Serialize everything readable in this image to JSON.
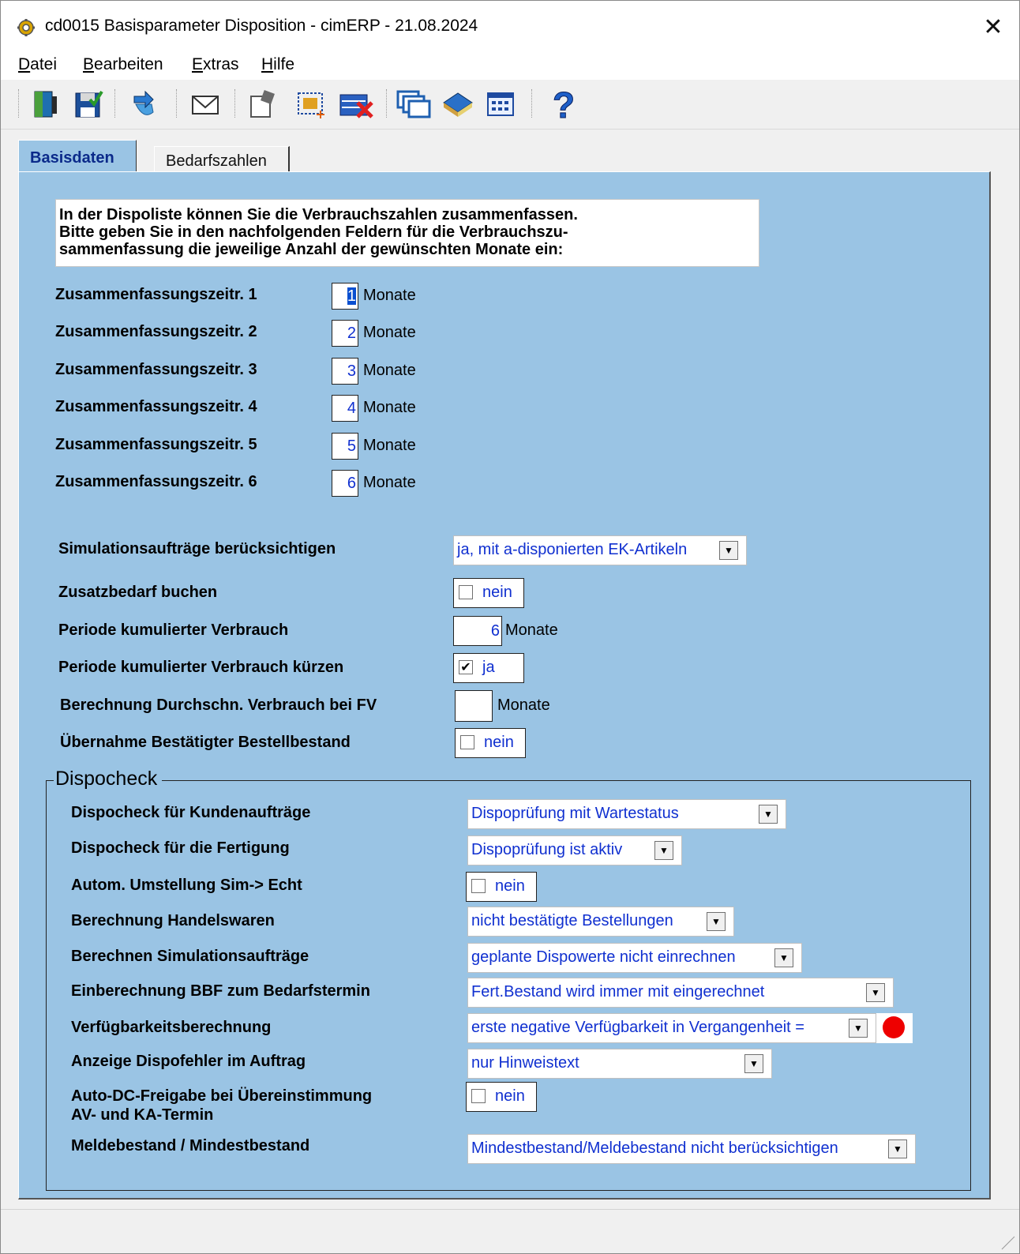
{
  "window": {
    "title": "cd0015 Basisparameter Disposition - cimERP - 21.08.2024",
    "close_glyph": "✕"
  },
  "menu": [
    {
      "underline": "D",
      "rest": "atei"
    },
    {
      "underline": "B",
      "rest": "earbeiten"
    },
    {
      "underline": "E",
      "rest": "xtras"
    },
    {
      "underline": "H",
      "rest": "ilfe"
    }
  ],
  "toolbar": {
    "icons": [
      "exit-icon",
      "save-icon",
      "import-icon",
      "mail-icon",
      "edit-icon",
      "new-record-icon",
      "delete-icon",
      "windows-icon",
      "book-icon",
      "table-icon",
      "help-icon"
    ]
  },
  "tabs": {
    "active": "Basisdaten",
    "inactive": "Bedarfszahlen"
  },
  "info": {
    "line1": "In der Dispoliste können Sie die Verbrauchszahlen zusammenfassen.",
    "line2": "Bitte geben Sie in den nachfolgenden Feldern für die Verbrauchszu-",
    "line3": "sammenfassung die jeweilige Anzahl der gewünschten Monate ein:"
  },
  "periods": [
    {
      "label": "Zusammenfassungszeitr. 1",
      "value": "1",
      "unit": "Monate"
    },
    {
      "label": "Zusammenfassungszeitr. 2",
      "value": "2",
      "unit": "Monate"
    },
    {
      "label": "Zusammenfassungszeitr. 3",
      "value": "3",
      "unit": "Monate"
    },
    {
      "label": "Zusammenfassungszeitr. 4",
      "value": "4",
      "unit": "Monate"
    },
    {
      "label": "Zusammenfassungszeitr. 5",
      "value": "5",
      "unit": "Monate"
    },
    {
      "label": "Zusammenfassungszeitr. 6",
      "value": "6",
      "unit": "Monate"
    }
  ],
  "settings": {
    "sim_label": "Simulationsaufträge berücksichtigen",
    "sim_value": "ja, mit a-disponierten EK-Artikeln",
    "zusatz_label": "Zusatzbedarf buchen",
    "zusatz_value": "nein",
    "periode_label": "Periode kumulierter Verbrauch",
    "periode_value": "6",
    "periode_unit": "Monate",
    "kuerzen_label": "Periode kumulierter Verbrauch kürzen",
    "kuerzen_value": "ja",
    "durchschn_label": "Berechnung Durchschn. Verbrauch bei FV",
    "durchschn_value": "",
    "durchschn_unit": "Monate",
    "uebernahme_label": "Übernahme Bestätigter Bestellbestand",
    "uebernahme_value": "nein"
  },
  "dispocheck": {
    "title": "Dispocheck",
    "kunden_label": "Dispocheck für Kundenaufträge",
    "kunden_value": "Dispoprüfung mit Wartestatus",
    "fertigung_label": "Dispocheck für die Fertigung",
    "fertigung_value": "Dispoprüfung ist aktiv",
    "umstellung_label": "Autom. Umstellung Sim-> Echt",
    "umstellung_value": "nein",
    "handel_label": "Berechnung Handelswaren",
    "handel_value": "nicht bestätigte Bestellungen",
    "simauf_label": "Berechnen Simulationsaufträge",
    "simauf_value": "geplante Dispowerte nicht einrechnen",
    "bbf_label": "Einberechnung BBF zum Bedarfstermin",
    "bbf_value": "Fert.Bestand wird immer mit eingerechnet",
    "verf_label": "Verfügbarkeitsberechnung",
    "verf_value": "erste negative Verfügbarkeit in Vergangenheit =",
    "verf_status_color": "#ee0000",
    "fehler_label": "Anzeige Dispofehler im Auftrag",
    "fehler_value": "nur Hinweistext",
    "autodc_label1": "Auto-DC-Freigabe bei Übereinstimmung",
    "autodc_label2": "AV- und KA-Termin",
    "autodc_value": "nein",
    "melde_label": "Meldebestand / Mindestbestand",
    "melde_value": "Mindestbestand/Meldebestand nicht berücksichtigen"
  },
  "colors": {
    "panel": "#9ac4e4",
    "value_text": "#1030d0",
    "tab_active_text": "#0b2a8a"
  }
}
